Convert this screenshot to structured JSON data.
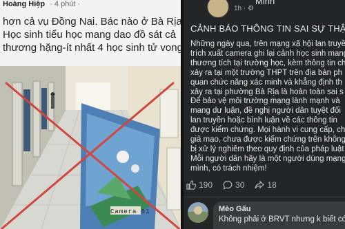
{
  "left_post": {
    "author": "Hoàng Hiệp",
    "time": "· 4 phút ·",
    "lines": [
      "hơn cả vụ Đồng Nai. Bác nào ở Bà Rịa",
      "Học sinh tiểu học mang dao đồ sát cả",
      "thương hặng-ít nhất 4 học sinh tử vong."
    ],
    "camera_label": "Camera 01"
  },
  "right_post": {
    "author": "Minh",
    "time": "1h · ⚙",
    "title": "CẢNH BÁO THÔNG TIN SAI SỰ THẬT",
    "lines": [
      "Những ngày qua, trên mạng xã hội lan truyền",
      "trích xuất camera ghi lại cảnh học sinh mang",
      "thương tích tại trường học, kèm thông tin ch",
      "xảy ra tại một trường THPT trên địa bàn ph",
      "quan chức năng xác minh và khẳng định th",
      "xảy ra tại phường Bà Rịa là hoàn toàn sai s",
      "Để bảo vệ môi trường mạng lành mạnh và",
      "mang dư luận, đề nghị người dân tuyệt đối",
      "lan truyền hoặc bình luận về các thông tin",
      "được kiểm chứng. Mọi hành vi cung cấp, ch",
      "giả mạo, chưa được kiểm chứng trên không",
      "bị xử lý nghiêm theo quy định của pháp luật",
      "Mỗi người dân hãy là một người dùng mạng",
      "mình, có trách nhiệm!"
    ],
    "reactions": {
      "likes": "190",
      "comments": "30",
      "shares": "18"
    },
    "comment": {
      "author": "Mèo Gấu",
      "text": "Không phải ở BRVT nhưng k biết có"
    }
  },
  "colors": {
    "dark_bg": "#242526",
    "text_light": "#e4e6eb",
    "muted": "#b0b3b8",
    "cross_red": "#d0463f"
  }
}
